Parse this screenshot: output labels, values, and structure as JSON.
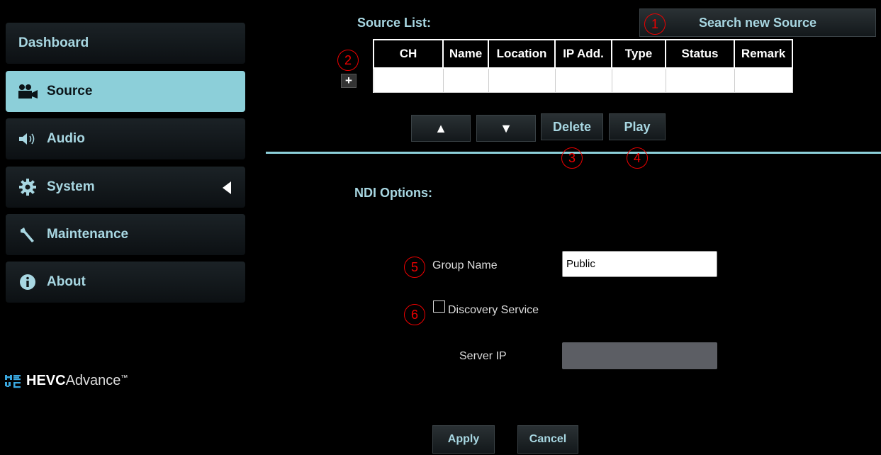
{
  "sidebar": {
    "items": [
      {
        "label": "Dashboard",
        "icon": "dashboard"
      },
      {
        "label": "Source",
        "icon": "video-camera-icon",
        "active": true
      },
      {
        "label": "Audio",
        "icon": "speaker-icon"
      },
      {
        "label": "System",
        "icon": "gear-icon",
        "expand": "chevron-left-icon"
      },
      {
        "label": "Maintenance",
        "icon": "wrench-icon"
      },
      {
        "label": "About",
        "icon": "info-icon"
      }
    ],
    "logo": {
      "bold": "HEVC",
      "thin": "Advance",
      "tm": "™"
    }
  },
  "source_list": {
    "title": "Source List:",
    "search_button": "Search new Source",
    "add_button": "+",
    "columns": [
      "CH",
      "Name",
      "Location",
      "IP Add.",
      "Type",
      "Status",
      "Remark"
    ],
    "up_button": "▲",
    "down_button": "▼",
    "delete_button": "Delete",
    "play_button": "Play"
  },
  "ndi": {
    "title": "NDI Options:",
    "group_name_label": "Group Name",
    "group_name_value": "Public",
    "discovery_label": "Discovery Service",
    "discovery_checked": false,
    "server_ip_label": "Server IP",
    "server_ip_value": ""
  },
  "footer": {
    "apply": "Apply",
    "cancel": "Cancel"
  },
  "markers": [
    "1",
    "2",
    "3",
    "4",
    "5",
    "6"
  ],
  "colors": {
    "accent": "#8ccfd9",
    "marker": "#ee0000",
    "background": "#000000"
  }
}
